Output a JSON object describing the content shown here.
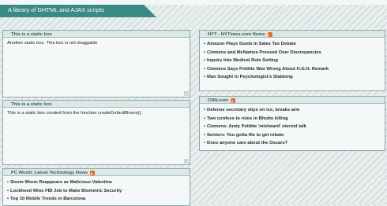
{
  "window": {
    "title_fragment": "",
    "banner": "A library of DHTML and AJAX scripts"
  },
  "boxes": {
    "static1": {
      "header": "This is a static box",
      "body": "Another static box. This box is not draggable"
    },
    "static2": {
      "header": "This is a static box",
      "body": "This is a static box created from the function createDefaultBoxes()."
    },
    "nyt": {
      "header": "NYT - NYTimes.com Home",
      "icon": "rss-feed-icon",
      "items": [
        "Amazon Plays Dumb in Sales Tax Debate",
        "Clemens and McNamee Pressed Over Discrepancies",
        "Inquiry Into Medical Rule Setting",
        "Clemens Says Pettitte Was Wrong About H.G.H. Remark",
        "Man Sought in Psychologist's Stabbing"
      ]
    },
    "cnn": {
      "header": "CNN.com",
      "icon": "rss-feed-icon",
      "items": [
        "Defense secretary slips on ice, breaks arm",
        "Two confess to roles in Bhutto killing",
        "Clemens: Andy Pettitte 'misheard' steroid talk",
        "Seniors: You gotta file to get rebate",
        "Does anyone care about the Oscars?"
      ]
    },
    "pcworld": {
      "header": "PC World: Latest Technology News",
      "icon": "rss-feed-icon",
      "items": [
        "Storm Worm Reappears as Malicious Valentine",
        "Lockheed Wins FBI Job to Make Biometric Security",
        "Top 10 Mobile Trends in Barcelona"
      ]
    }
  },
  "colors": {
    "banner": "#3a8a86",
    "box_border": "#8aa9a7",
    "box_header": "#dbe8e6",
    "rss_icon": "#e8692c"
  }
}
